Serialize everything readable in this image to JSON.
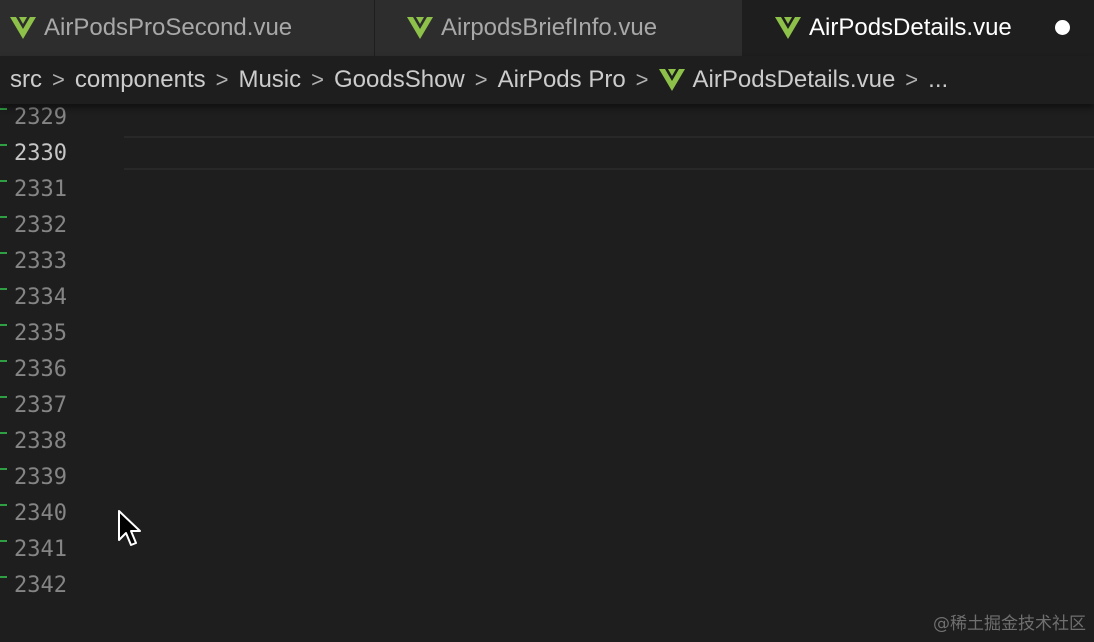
{
  "tabs": [
    {
      "label": "AirPodsProSecond.vue",
      "icon": "vue-icon",
      "active": false
    },
    {
      "label": "AirpodsBriefInfo.vue",
      "icon": "vue-icon",
      "active": false
    },
    {
      "label": "AirPodsDetails.vue",
      "icon": "vue-icon",
      "active": true,
      "unsaved": true
    }
  ],
  "breadcrumb": {
    "items": [
      "src",
      "components",
      "Music",
      "GoodsShow",
      "AirPods Pro",
      "AirPodsDetails.vue",
      "..."
    ],
    "separator": ">"
  },
  "editor": {
    "line_numbers": [
      "2329",
      "2330",
      "2331",
      "2332",
      "2333",
      "2334",
      "2335",
      "2336",
      "2337",
      "2338",
      "2339",
      "2340",
      "2341",
      "2342"
    ],
    "active_line": "2330"
  },
  "watermark": "@稀土掘金技术社区",
  "colors": {
    "vue_green": "#8dc149",
    "background": "#1e1e1e",
    "tabbar": "#252526",
    "git_added": "#2ea043"
  }
}
